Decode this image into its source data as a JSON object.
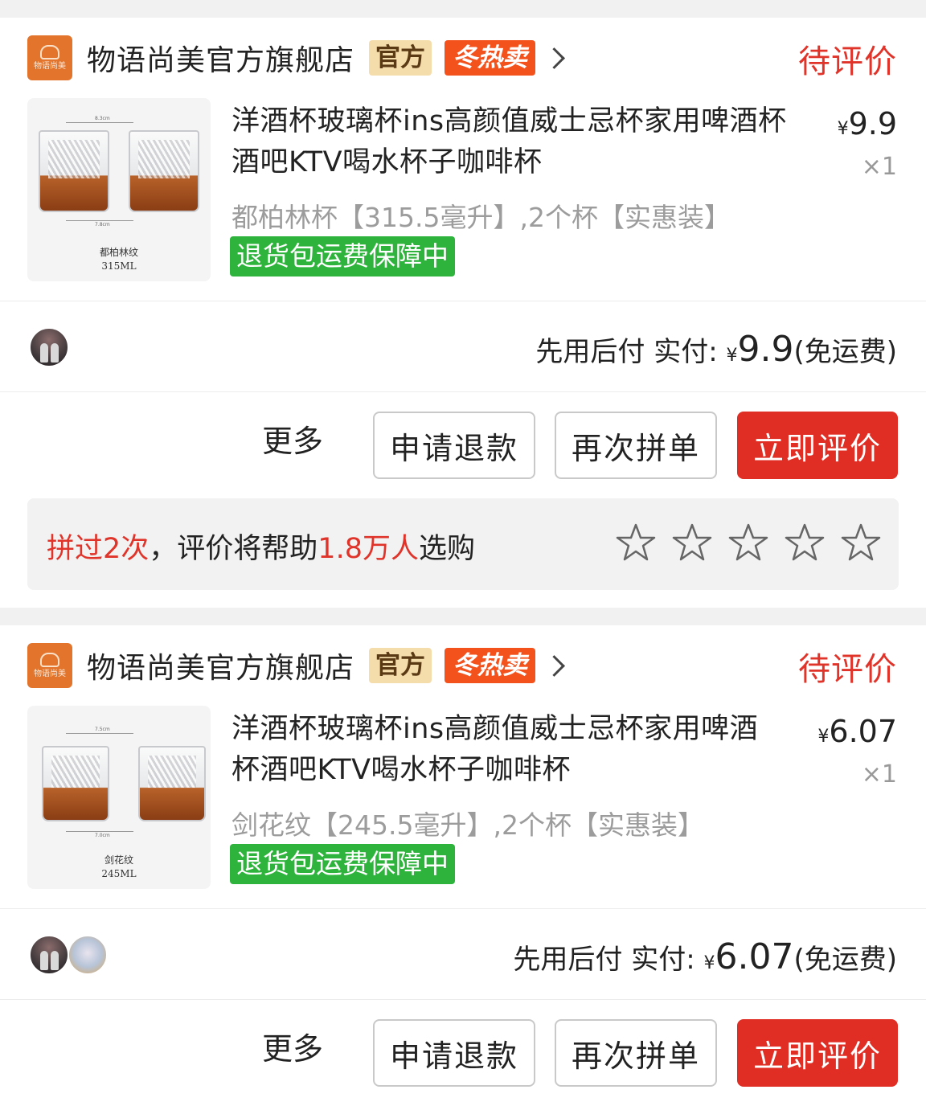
{
  "orders": [
    {
      "store": {
        "logo_text": "物语尚美",
        "name": "物语尚美官方旗舰店",
        "badge_official": "官方",
        "badge_hot": "冬热卖",
        "status": "待评价"
      },
      "product": {
        "title": "洋酒杯玻璃杯ins高颜值威士忌杯家用啤酒杯酒吧KTV喝水杯子咖啡杯",
        "image_caption_line1": "都柏林纹",
        "image_caption_line2": "315ML",
        "currency": "¥",
        "price": "9.9",
        "quantity": "×1",
        "spec": "都柏林杯【315.5毫升】,2个杯【实惠装】",
        "guarantee": "退货包运费保障中"
      },
      "payment": {
        "label": "先用后付 实付:",
        "currency": "¥",
        "amount": "9.9",
        "note": "(免运费)"
      },
      "actions": {
        "more": "更多",
        "refund": "申请退款",
        "reorder": "再次拼单",
        "review": "立即评价"
      },
      "review_prompt": {
        "part1": "拼过2次",
        "part2": "，评价将帮助",
        "part3": "1.8万人",
        "part4": "选购"
      }
    },
    {
      "store": {
        "logo_text": "物语尚美",
        "name": "物语尚美官方旗舰店",
        "badge_official": "官方",
        "badge_hot": "冬热卖",
        "status": "待评价"
      },
      "product": {
        "title": "洋酒杯玻璃杯ins高颜值威士忌杯家用啤酒杯酒吧KTV喝水杯子咖啡杯",
        "image_caption_line1": "剑花纹",
        "image_caption_line2": "245ML",
        "currency": "¥",
        "price": "6.07",
        "quantity": "×1",
        "spec": "剑花纹【245.5毫升】,2个杯【实惠装】",
        "guarantee": "退货包运费保障中"
      },
      "payment": {
        "label": "先用后付 实付:",
        "currency": "¥",
        "amount": "6.07",
        "note": "(免运费)"
      },
      "actions": {
        "more": "更多",
        "refund": "申请退款",
        "reorder": "再次拼单",
        "review": "立即评价"
      }
    }
  ],
  "colors": {
    "accent_red": "#e02e24",
    "status_red": "#e0342a",
    "guarantee_green": "#2eb43d",
    "official_badge": "#f5dcab",
    "hot_badge": "#f3521d"
  },
  "icons": [
    "store-logo-icon",
    "chevron-right-icon",
    "star-outline-icon",
    "avatar"
  ]
}
